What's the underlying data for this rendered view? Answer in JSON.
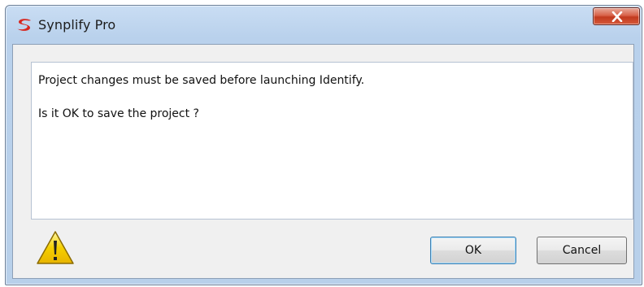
{
  "window": {
    "title": "Synplify Pro",
    "logo_icon": "synplify-logo-icon",
    "close_icon": "close-icon"
  },
  "message": {
    "line1": "Project changes must be saved before launching Identify.",
    "line2": "Is it OK to save the project ?"
  },
  "icon": {
    "name": "warning-icon",
    "color": "#f5d000"
  },
  "buttons": {
    "ok_label": "OK",
    "cancel_label": "Cancel"
  },
  "colors": {
    "titlebar": "#b9d1ec",
    "close_button": "#c23a1f",
    "logo_red": "#d7261e"
  }
}
